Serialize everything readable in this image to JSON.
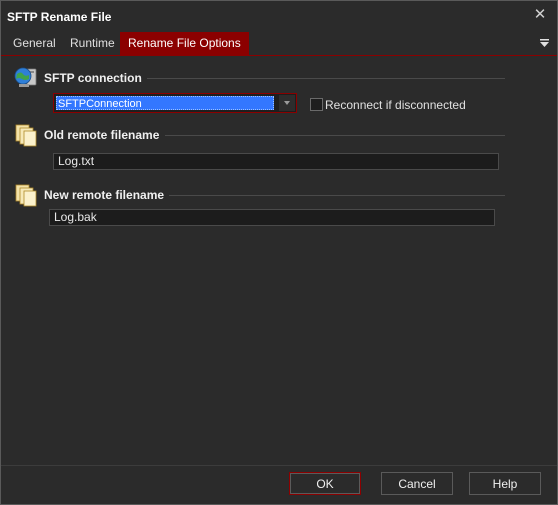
{
  "window": {
    "title": "SFTP Rename File"
  },
  "tabs": [
    {
      "label": "General"
    },
    {
      "label": "Runtime"
    },
    {
      "label": "Rename File Options"
    }
  ],
  "sftp": {
    "title": "SFTP connection",
    "connection_value": "SFTPConnection",
    "reconnect_label": "Reconnect if disconnected",
    "reconnect_checked": false
  },
  "old_file": {
    "title": "Old remote filename",
    "value": "Log.txt"
  },
  "new_file": {
    "title": "New remote filename",
    "value": "Log.bak"
  },
  "buttons": {
    "ok": "OK",
    "cancel": "Cancel",
    "help": "Help"
  },
  "colors": {
    "accent": "#8b0000",
    "selection": "#3377ff",
    "background": "#2b2b2b"
  }
}
